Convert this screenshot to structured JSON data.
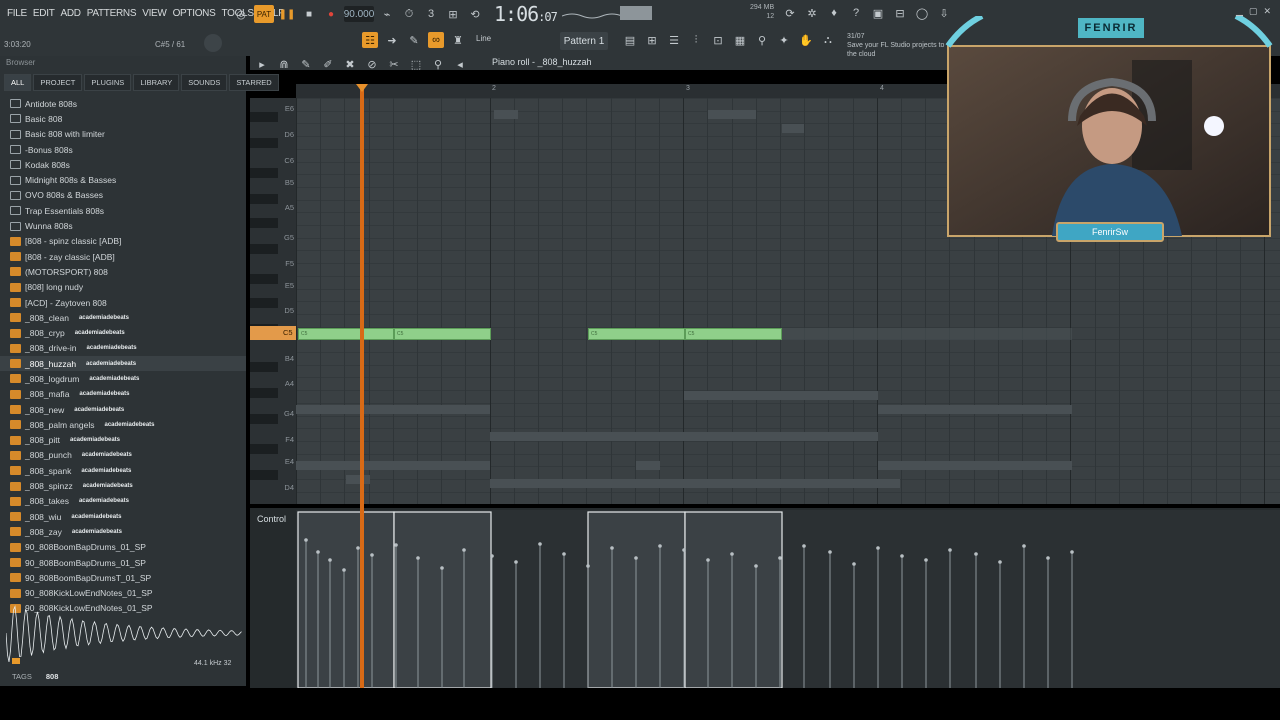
{
  "menu": [
    "FILE",
    "EDIT",
    "ADD",
    "PATTERNS",
    "VIEW",
    "OPTIONS",
    "TOOLS",
    "HELP"
  ],
  "transport": {
    "pat_label": "PAT",
    "tempo": "90.000"
  },
  "time": {
    "main": "1:06",
    "sub": ":07"
  },
  "cpu": {
    "mem": "294 MB",
    "voices": "12"
  },
  "status": {
    "position": "3:03:20",
    "note": "C#5 / 61"
  },
  "toolbar": {
    "line_mode": "Line",
    "pattern": "Pattern 1"
  },
  "hint": {
    "date": "31/07",
    "text": "Save your FL Studio projects to the cloud"
  },
  "piano_roll": {
    "title": "Piano roll - _808_huzzah",
    "control_label": "Control",
    "ruler": [
      "2",
      "3",
      "4"
    ],
    "keys": [
      "E6",
      "D6",
      "C6",
      "B5",
      "A5",
      "G5",
      "F5",
      "E5",
      "D5",
      "C5",
      "B4",
      "A4",
      "G4",
      "F4",
      "E4",
      "D4"
    ],
    "note_label": "C5"
  },
  "browser": {
    "title": "Browser",
    "tabs": [
      "ALL",
      "PROJECT",
      "PLUGINS",
      "LIBRARY",
      "SOUNDS",
      "STARRED"
    ],
    "items": [
      {
        "label": "Antidote 808s",
        "type": "folder"
      },
      {
        "label": "Basic 808",
        "type": "folder"
      },
      {
        "label": "Basic 808 with limiter",
        "type": "folder"
      },
      {
        "label": "-Bonus 808s",
        "type": "folder"
      },
      {
        "label": "Kodak 808s",
        "type": "folder"
      },
      {
        "label": "Midnight 808s & Basses",
        "type": "folder"
      },
      {
        "label": "OVO 808s & Basses",
        "type": "folder"
      },
      {
        "label": "Trap Essentials 808s",
        "type": "folder"
      },
      {
        "label": "Wunna 808s",
        "type": "folder"
      },
      {
        "label": "[808 - spinz classic [ADB]",
        "type": "audio"
      },
      {
        "label": "[808 - zay classic [ADB]",
        "type": "audio"
      },
      {
        "label": "(MOTORSPORT) 808",
        "type": "audio"
      },
      {
        "label": "[808] long nudy",
        "type": "audio"
      },
      {
        "label": "[ACD] - Zaytoven 808",
        "type": "audio"
      },
      {
        "label": "_808_clean",
        "type": "audio",
        "tag": "academiadebeats"
      },
      {
        "label": "_808_cryp",
        "type": "audio",
        "tag": "academiadebeats"
      },
      {
        "label": "_808_drive-in",
        "type": "audio",
        "tag": "academiadebeats"
      },
      {
        "label": "_808_huzzah",
        "type": "audio",
        "tag": "academiadebeats",
        "selected": true
      },
      {
        "label": "_808_logdrum",
        "type": "audio",
        "tag": "academiadebeats"
      },
      {
        "label": "_808_mafia",
        "type": "audio",
        "tag": "academiadebeats"
      },
      {
        "label": "_808_new",
        "type": "audio",
        "tag": "academiadebeats"
      },
      {
        "label": "_808_palm angels",
        "type": "audio",
        "tag": "academiadebeats"
      },
      {
        "label": "_808_pitt",
        "type": "audio",
        "tag": "academiadebeats"
      },
      {
        "label": "_808_punch",
        "type": "audio",
        "tag": "academiadebeats"
      },
      {
        "label": "_808_spank",
        "type": "audio",
        "tag": "academiadebeats"
      },
      {
        "label": "_808_spinzz",
        "type": "audio",
        "tag": "academiadebeats"
      },
      {
        "label": "_808_takes",
        "type": "audio",
        "tag": "academiadebeats"
      },
      {
        "label": "_808_wiu",
        "type": "audio",
        "tag": "academiadebeats"
      },
      {
        "label": "_808_zay",
        "type": "audio",
        "tag": "academiadebeats"
      },
      {
        "label": "90_808BoomBapDrums_01_SP",
        "type": "audio"
      },
      {
        "label": "90_808BoomBapDrums_01_SP",
        "type": "audio"
      },
      {
        "label": "90_808BoomBapDrumsT_01_SP",
        "type": "audio"
      },
      {
        "label": "90_808KickLowEndNotes_01_SP",
        "type": "audio"
      },
      {
        "label": "90_808KickLowEndNotes_01_SP",
        "type": "audio"
      }
    ],
    "wave_info": "44.1 kHz 32",
    "tags_label": "TAGS",
    "tags_value": "808"
  },
  "webcam": {
    "channel": "FENRIR",
    "handle": "FenrirSw"
  },
  "colors": {
    "note": "#8fd08a",
    "playhead": "#d86a16",
    "accent": "#e89a2b"
  }
}
